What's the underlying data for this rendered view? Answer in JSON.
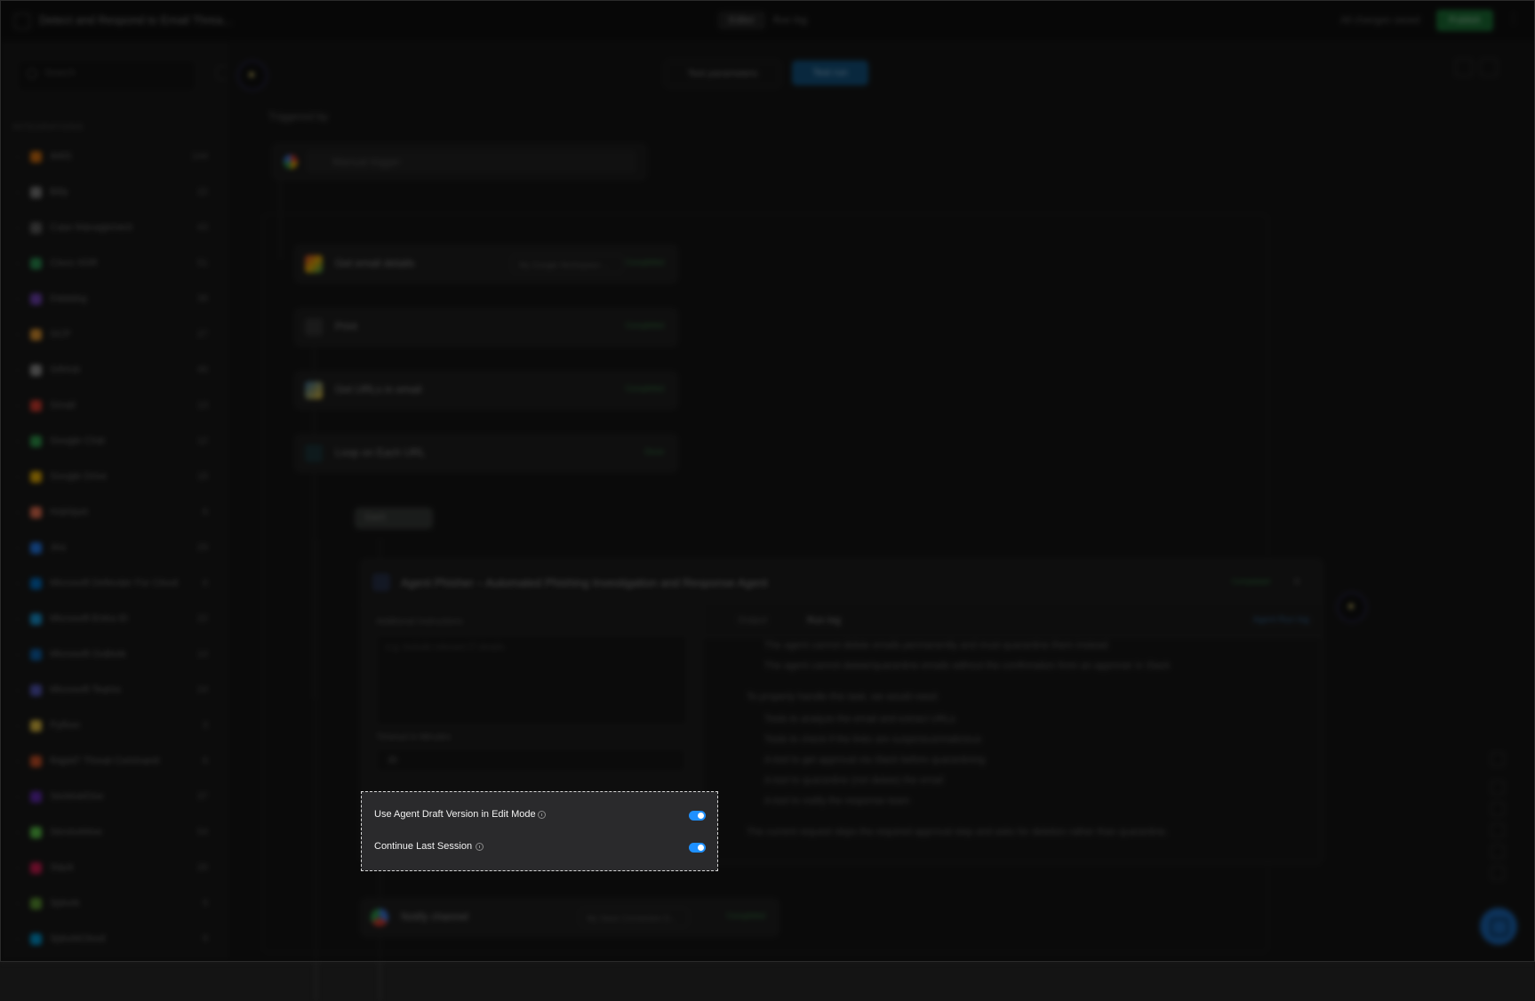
{
  "app": {
    "title": "Detect and Respond to Email Threa...",
    "tabs": [
      "Editor",
      "Run log"
    ],
    "status": "All changes saved",
    "publish_label": "Publish"
  },
  "sidebar": {
    "search_placeholder": "Search",
    "section_title": "INTEGRATIONS",
    "items": [
      {
        "label": "AWS",
        "count": "144",
        "color": "#e47911"
      },
      {
        "label": "Bitly",
        "count": "22",
        "color": "#888888"
      },
      {
        "label": "Case Management",
        "count": "43",
        "color": "#666666"
      },
      {
        "label": "Cisco XDR",
        "count": "51",
        "color": "#2e9e5a"
      },
      {
        "label": "Datadog",
        "count": "38",
        "color": "#7a48c4"
      },
      {
        "label": "GCP",
        "count": "27",
        "color": "#f4a234"
      },
      {
        "label": "GitHub",
        "count": "46",
        "color": "#9a9a9a"
      },
      {
        "label": "Gmail",
        "count": "13",
        "color": "#e94235"
      },
      {
        "label": "Google Chat",
        "count": "12",
        "color": "#34a853"
      },
      {
        "label": "Google Drive",
        "count": "18",
        "color": "#fbbc05"
      },
      {
        "label": "HubSpot",
        "count": "8",
        "color": "#ff7a59"
      },
      {
        "label": "Jira",
        "count": "29",
        "color": "#2684ff"
      },
      {
        "label": "Microsoft Defender For Cloud",
        "count": "6",
        "color": "#0078d4"
      },
      {
        "label": "Microsoft Entra ID",
        "count": "22",
        "color": "#1aa3e8"
      },
      {
        "label": "Microsoft Outlook",
        "count": "14",
        "color": "#0f6cbd"
      },
      {
        "label": "Microsoft Teams",
        "count": "24",
        "color": "#5b5fc7"
      },
      {
        "label": "Python",
        "count": "3",
        "color": "#f7d046"
      },
      {
        "label": "Rapid7 Threat Command",
        "count": "8",
        "color": "#e05a2b"
      },
      {
        "label": "SentinelOne",
        "count": "37",
        "color": "#6b2fbf"
      },
      {
        "label": "ServiceNow",
        "count": "54",
        "color": "#62d84e"
      },
      {
        "label": "Slack",
        "count": "26",
        "color": "#e01e5a"
      },
      {
        "label": "Splunk",
        "count": "9",
        "color": "#65a637"
      },
      {
        "label": "SplunkCloud",
        "count": "9",
        "color": "#00a4e4"
      }
    ]
  },
  "canvas": {
    "test_button": "Test parameters",
    "run_button": "Test run",
    "trigger_label": "Triggered by",
    "trigger_field": "Manual trigger",
    "steps": [
      {
        "name": "Get email details",
        "connection": "My Google Workspace ...",
        "status": "Completed"
      },
      {
        "name": "Print",
        "connection": "",
        "status": "Completed"
      },
      {
        "name": "Get URLs in email",
        "connection": "",
        "status": "Completed"
      },
      {
        "name": "Loop on Each URL",
        "connection": "",
        "status": "Done"
      }
    ],
    "branch_label": "Each",
    "agent_step": {
      "name": "Agent Phisher – Automated Phishing Investigation and Response Agent",
      "status": "Completed",
      "instructions_label": "Additional Instructions",
      "instructions_placeholder": "e.g. Include relevant IT details",
      "timeout_label": "Timeout in Minutes",
      "timeout_value": "30",
      "right_tabs": [
        "Output",
        "Run log"
      ],
      "right_link": "Agent Run log",
      "output_lines": [
        "The agent cannot delete emails permanently and must quarantine them instead",
        "The agent cannot delete/quarantine emails without the confirmation from an approver in Slack",
        "To properly handle this task, we would need:",
        "Tools to analyze the email and extract URLs",
        "Tools to check if the links are suspicious/malicious",
        "A tool to get approval via Slack before quarantining",
        "A tool to quarantine (not delete) the email",
        "A tool to notify the response team",
        "The current request skips the required approval step and asks for deletion rather than quarantine."
      ]
    },
    "notify_step": {
      "name": "Notify channel",
      "connection": "My Slack Connection D...",
      "status": "Completed"
    }
  },
  "options_panel": {
    "use_draft": {
      "label": "Use Agent Draft Version in Edit Mode",
      "enabled": true
    },
    "continue_session": {
      "label": "Continue Last Session",
      "enabled": true
    }
  }
}
